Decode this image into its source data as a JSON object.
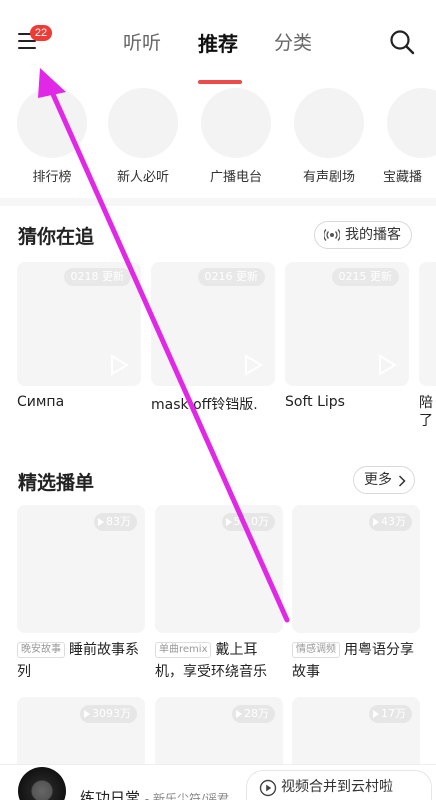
{
  "header": {
    "notification_count": "22",
    "tabs": [
      "听听",
      "推荐",
      "分类"
    ],
    "active_tab": "推荐"
  },
  "shortcuts": [
    "排行榜",
    "新人必听",
    "广播电台",
    "有声剧场",
    "宝藏播"
  ],
  "following": {
    "title": "猜你在追",
    "my_podcast_label": "我的播客",
    "items": [
      {
        "badge": "0218 更新",
        "title": "Симпа"
      },
      {
        "badge": "0216 更新",
        "title": "mask off铃铛版."
      },
      {
        "badge": "0215 更新",
        "title": "Soft Lips"
      },
      {
        "badge": "",
        "title": "陪了"
      }
    ]
  },
  "playlists": {
    "title": "精选播单",
    "more_label": "更多",
    "row1": [
      {
        "count": "83万",
        "tag": "晚安故事",
        "title": "睡前故事系列"
      },
      {
        "count": "50.0万",
        "tag": "单曲remix",
        "title": "戴上耳机，享受环绕音乐"
      },
      {
        "count": "43万",
        "tag": "情感调频",
        "title": "用粤语分享故事"
      }
    ],
    "row2": [
      {
        "count": "3093万"
      },
      {
        "count": "28万"
      },
      {
        "count": "17万"
      }
    ]
  },
  "player": {
    "song": "练功日常",
    "artist": "- 新乐尘符/谣君",
    "merge_label": "视频合并到云村啦"
  },
  "colors": {
    "accent": "#ee4a4a",
    "badge": "#ef3b36",
    "annotation_arrow": "#e028e6"
  }
}
